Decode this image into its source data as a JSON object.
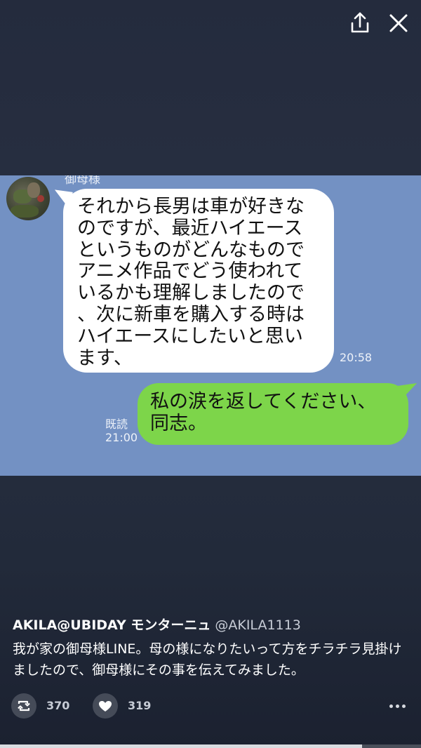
{
  "topbar": {
    "share_icon": "share-icon",
    "close_icon": "close-icon"
  },
  "chat": {
    "sender_name": "御母様",
    "received_message": "それから長男は車が好きな\nのですが、最近ハイエース\nというものがどんなもので\nアニメ作品でどう使われて\nいるかも理解しましたので\n、次に新車を購入する時は\nハイエースにしたいと思い\nます、",
    "received_time": "20:58",
    "sent_message": "私の涙を返してください、\n同志。",
    "read_label": "既読",
    "sent_time": "21:00",
    "colors": {
      "background": "#7391c3",
      "received_bubble": "#ffffff",
      "sent_bubble": "#7dd54a"
    }
  },
  "tweet": {
    "author_name": "AKILA@UBIDAY モンターニュ",
    "author_handle": "@AKILA1113",
    "text": "我が家の御母様LINE。母の様になりたいって方をチラチラ見掛けましたので、御母様にその事を伝えてみました。",
    "retweet_count": "370",
    "like_count": "319"
  },
  "video_progress": 0.86
}
